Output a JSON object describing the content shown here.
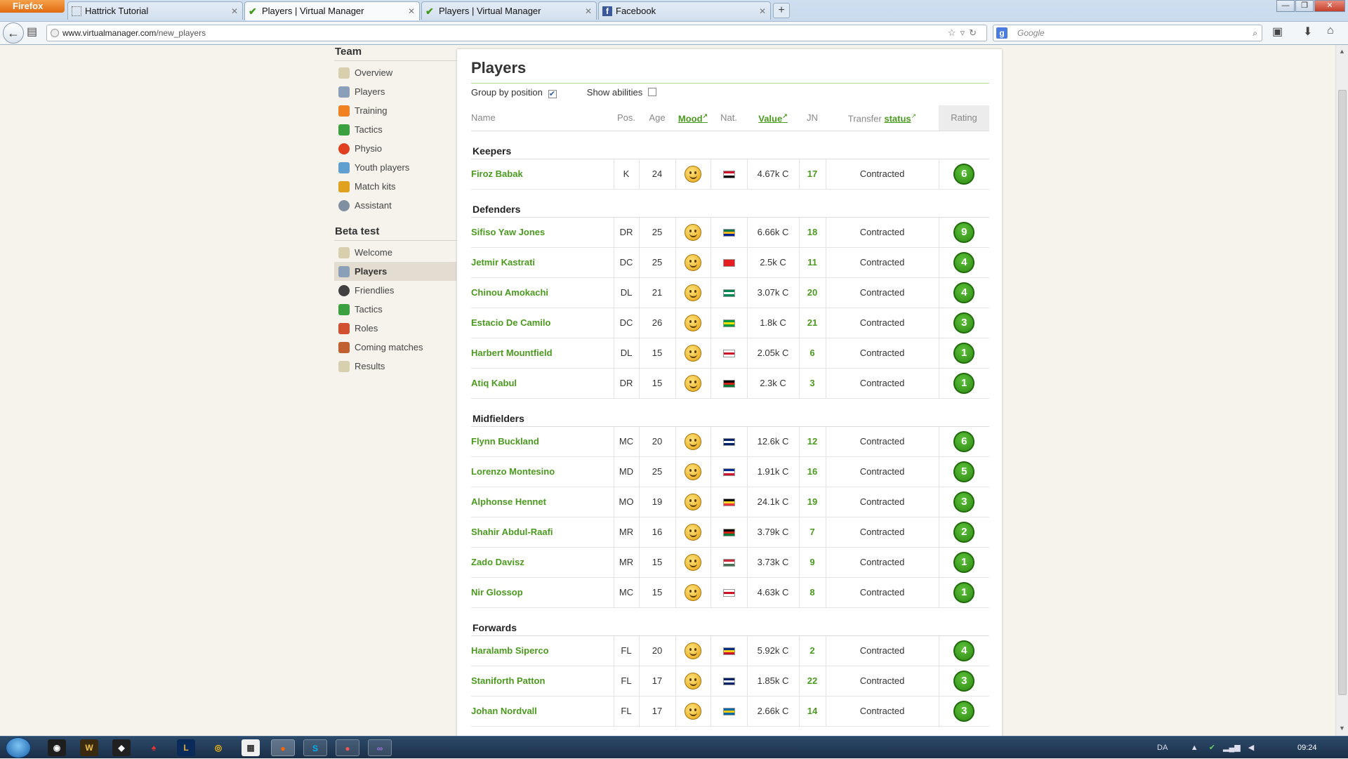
{
  "browser": {
    "app_button": "Firefox",
    "tabs": [
      {
        "label": "Hattrick Tutorial",
        "active": false
      },
      {
        "label": "Players | Virtual Manager",
        "active": true
      },
      {
        "label": "Players | Virtual Manager",
        "active": false
      },
      {
        "label": "Facebook",
        "active": false
      }
    ],
    "url_domain": "www.virtualmanager.com",
    "url_path": "/new_players",
    "search_placeholder": "Google",
    "new_tab_symbol": "+"
  },
  "sidebar": {
    "team_heading": "Team",
    "team_items": [
      {
        "label": "Overview",
        "icon": "notepad-icon"
      },
      {
        "label": "Players",
        "icon": "players-icon"
      },
      {
        "label": "Training",
        "icon": "cone-icon"
      },
      {
        "label": "Tactics",
        "icon": "tactics-icon"
      },
      {
        "label": "Physio",
        "icon": "heart-icon"
      },
      {
        "label": "Youth players",
        "icon": "youth-icon"
      },
      {
        "label": "Match kits",
        "icon": "shirt-icon"
      },
      {
        "label": "Assistant",
        "icon": "magnifier-icon"
      }
    ],
    "beta_heading": "Beta test",
    "beta_items": [
      {
        "label": "Welcome",
        "icon": "notepad-icon"
      },
      {
        "label": "Players",
        "icon": "players-icon",
        "active": true
      },
      {
        "label": "Friendlies",
        "icon": "football-icon"
      },
      {
        "label": "Tactics",
        "icon": "tactics-icon"
      },
      {
        "label": "Roles",
        "icon": "barchart-icon"
      },
      {
        "label": "Coming matches",
        "icon": "calendar-icon"
      },
      {
        "label": "Results",
        "icon": "notepad-icon"
      }
    ]
  },
  "main": {
    "title": "Players",
    "group_by_position_label": "Group by position",
    "group_by_position_checked": true,
    "show_abilities_label": "Show abilities",
    "show_abilities_checked": false,
    "columns": {
      "name": "Name",
      "pos": "Pos.",
      "age": "Age",
      "mood": "Mood",
      "nat": "Nat.",
      "value": "Value",
      "jn": "JN",
      "transfer_prefix": "Transfer",
      "transfer_link": "status",
      "rating": "Rating"
    },
    "groups": [
      {
        "heading": "Keepers",
        "players": [
          {
            "name": "Firoz Babak",
            "pos": "K",
            "age": "24",
            "flag": [
              "#ce1126",
              "#ffffff",
              "#000000"
            ],
            "value": "4.67k C",
            "jn": "17",
            "status": "Contracted",
            "rating": "6"
          }
        ]
      },
      {
        "heading": "Defenders",
        "players": [
          {
            "name": "Sifiso Yaw Jones",
            "pos": "DR",
            "age": "25",
            "flag": [
              "#007749",
              "#ffb81c",
              "#002395"
            ],
            "value": "6.66k C",
            "jn": "18",
            "status": "Contracted",
            "rating": "9"
          },
          {
            "name": "Jetmir Kastrati",
            "pos": "DC",
            "age": "25",
            "flag": [
              "#e41e20",
              "#e41e20",
              "#e41e20"
            ],
            "value": "2.5k C",
            "jn": "11",
            "status": "Contracted",
            "rating": "4"
          },
          {
            "name": "Chinou Amokachi",
            "pos": "DL",
            "age": "21",
            "flag": [
              "#008751",
              "#ffffff",
              "#008751"
            ],
            "value": "3.07k C",
            "jn": "20",
            "status": "Contracted",
            "rating": "4"
          },
          {
            "name": "Estacio De Camilo",
            "pos": "DC",
            "age": "26",
            "flag": [
              "#009c3b",
              "#ffdf00",
              "#009c3b"
            ],
            "value": "1.8k C",
            "jn": "21",
            "status": "Contracted",
            "rating": "3"
          },
          {
            "name": "Harbert Mountfield",
            "pos": "DL",
            "age": "15",
            "flag": [
              "#ffffff",
              "#ce1124",
              "#ffffff"
            ],
            "value": "2.05k C",
            "jn": "6",
            "status": "Contracted",
            "rating": "1"
          },
          {
            "name": "Atiq Kabul",
            "pos": "DR",
            "age": "15",
            "flag": [
              "#000000",
              "#d32011",
              "#007a36"
            ],
            "value": "2.3k C",
            "jn": "3",
            "status": "Contracted",
            "rating": "1"
          }
        ]
      },
      {
        "heading": "Midfielders",
        "players": [
          {
            "name": "Flynn Buckland",
            "pos": "MC",
            "age": "20",
            "flag": [
              "#012169",
              "#ffffff",
              "#012169"
            ],
            "value": "12.6k C",
            "jn": "12",
            "status": "Contracted",
            "rating": "6"
          },
          {
            "name": "Lorenzo Montesino",
            "pos": "MD",
            "age": "25",
            "flag": [
              "#002a8f",
              "#ffffff",
              "#cf142b"
            ],
            "value": "1.91k C",
            "jn": "16",
            "status": "Contracted",
            "rating": "5"
          },
          {
            "name": "Alphonse Hennet",
            "pos": "MO",
            "age": "19",
            "flag": [
              "#000000",
              "#fdda24",
              "#ef3340"
            ],
            "value": "24.1k C",
            "jn": "19",
            "status": "Contracted",
            "rating": "3"
          },
          {
            "name": "Shahir Abdul-Raafi",
            "pos": "MR",
            "age": "16",
            "flag": [
              "#000000",
              "#d32011",
              "#007a36"
            ],
            "value": "3.79k C",
            "jn": "7",
            "status": "Contracted",
            "rating": "2"
          },
          {
            "name": "Zado Davisz",
            "pos": "MR",
            "age": "15",
            "flag": [
              "#ce2939",
              "#ffffff",
              "#477050"
            ],
            "value": "3.73k C",
            "jn": "9",
            "status": "Contracted",
            "rating": "1"
          },
          {
            "name": "Nir Glossop",
            "pos": "MC",
            "age": "15",
            "flag": [
              "#ffffff",
              "#ce1124",
              "#ffffff"
            ],
            "value": "4.63k C",
            "jn": "8",
            "status": "Contracted",
            "rating": "1"
          }
        ]
      },
      {
        "heading": "Forwards",
        "players": [
          {
            "name": "Haralamb Siperco",
            "pos": "FL",
            "age": "20",
            "flag": [
              "#002b7f",
              "#fcd116",
              "#ce1126"
            ],
            "value": "5.92k C",
            "jn": "2",
            "status": "Contracted",
            "rating": "4"
          },
          {
            "name": "Staniforth Patton",
            "pos": "FL",
            "age": "17",
            "flag": [
              "#012169",
              "#ffffff",
              "#012169"
            ],
            "value": "1.85k C",
            "jn": "22",
            "status": "Contracted",
            "rating": "3"
          },
          {
            "name": "Johan Nordvall",
            "pos": "FL",
            "age": "17",
            "flag": [
              "#006aa7",
              "#fecc00",
              "#006aa7"
            ],
            "value": "2.66k C",
            "jn": "14",
            "status": "Contracted",
            "rating": "3"
          }
        ]
      }
    ]
  },
  "taskbar": {
    "language": "DA",
    "time": "09:24"
  }
}
